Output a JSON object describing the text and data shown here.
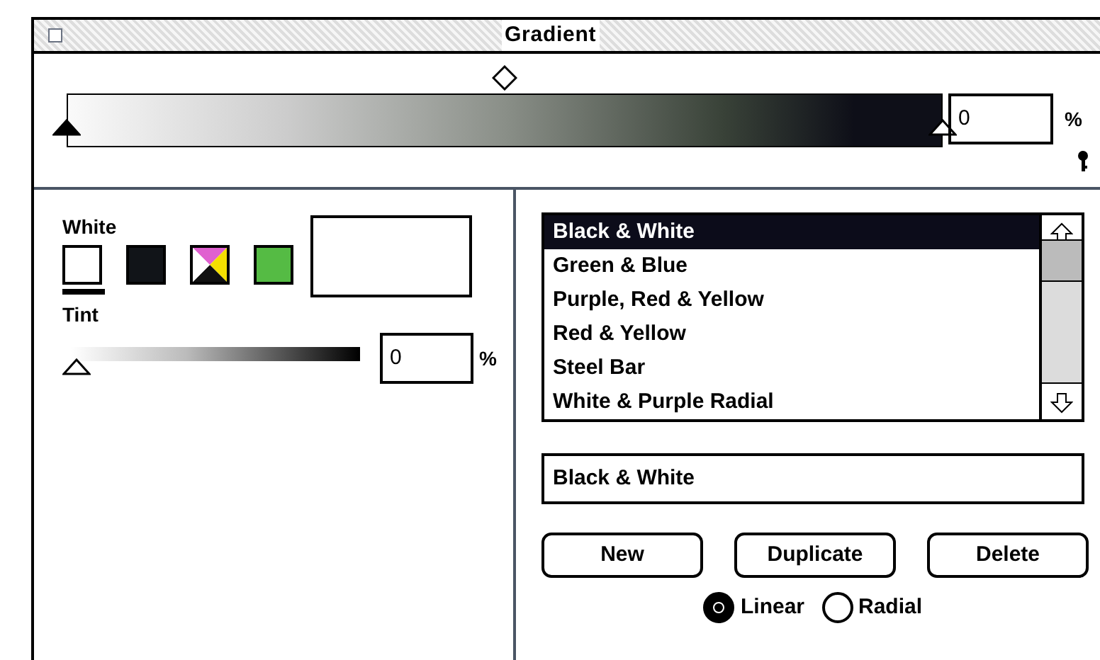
{
  "window": {
    "title": "Gradient"
  },
  "gradient": {
    "midpoint": {
      "level": 0.5
    },
    "stops": [
      {
        "level": 0,
        "selected": true
      },
      {
        "level": 1,
        "selected": false
      }
    ],
    "location": "0",
    "unit": "%"
  },
  "color": {
    "label": "White",
    "swatches": [
      {
        "kind": "solid",
        "color": "#ffffff",
        "selected": true
      },
      {
        "kind": "solid",
        "color": "#111418",
        "selected": false
      },
      {
        "kind": "process",
        "selected": false
      },
      {
        "kind": "solid",
        "color": "#55bb44",
        "selected": false
      }
    ]
  },
  "tint": {
    "label": "Tint",
    "level": 0,
    "value": "0",
    "unit": "%"
  },
  "gradient_list": {
    "items": [
      {
        "label": "Black & White",
        "selected": true
      },
      {
        "label": "Green & Blue",
        "selected": false
      },
      {
        "label": "Purple, Red & Yellow",
        "selected": false
      },
      {
        "label": "Red & Yellow",
        "selected": false
      },
      {
        "label": "Steel Bar",
        "selected": false
      },
      {
        "label": "White & Purple Radial",
        "selected": false
      }
    ]
  },
  "name_field": {
    "value": "Black & White"
  },
  "buttons": [
    "New",
    "Duplicate",
    "Delete"
  ],
  "type_options": [
    {
      "label": "Linear",
      "selected": true
    },
    {
      "label": "Radial",
      "selected": false
    }
  ]
}
